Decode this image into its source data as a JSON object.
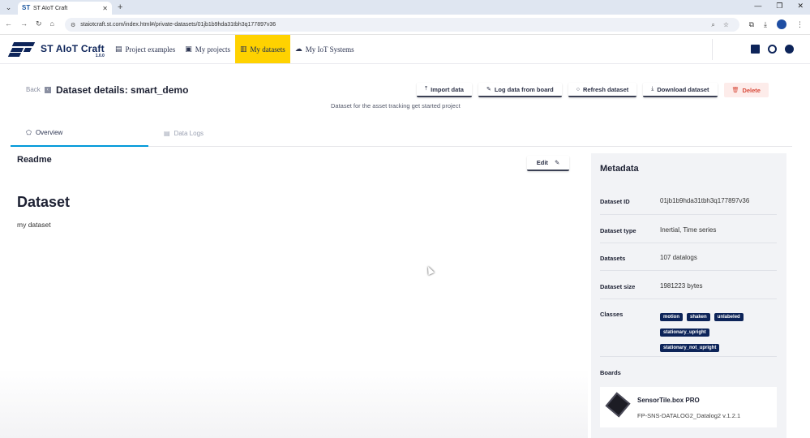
{
  "browser": {
    "tab_title": "ST AIoT Craft",
    "tab_close": "✕",
    "new_tab": "+",
    "url": "staiotcraft.st.com/index.html#/private-datasets/01jb1b9hda31tbh3q177897v36",
    "window_controls": [
      "—",
      "❐",
      "✕"
    ]
  },
  "app": {
    "name": "ST AIoT Craft",
    "version": "1.0.0",
    "nav": [
      {
        "label": "Project examples",
        "icon": "list-icon"
      },
      {
        "label": "My projects",
        "icon": "folder-icon"
      },
      {
        "label": "My datasets",
        "icon": "chart-icon",
        "active": true
      },
      {
        "label": "My IoT Systems",
        "icon": "cloud-icon"
      }
    ]
  },
  "page": {
    "back_label": "Back",
    "title": "Dataset details: smart_demo",
    "subtitle": "Dataset for the asset tracking get started project",
    "actions": {
      "import": "Import data",
      "log": "Log data from board",
      "refresh": "Refresh dataset",
      "download": "Download dataset",
      "delete": "Delete"
    },
    "tabs": {
      "overview": "Overview",
      "logs": "Data Logs"
    }
  },
  "readme": {
    "title": "Readme",
    "edit_label": "Edit",
    "heading": "Dataset",
    "text": "my dataset"
  },
  "metadata": {
    "title": "Metadata",
    "rows": {
      "id": {
        "key": "Dataset ID",
        "value": "01jb1b9hda31tbh3q177897v36"
      },
      "type": {
        "key": "Dataset type",
        "value": "Inertial, Time series"
      },
      "count": {
        "key": "Datasets",
        "value": "107 datalogs"
      },
      "size": {
        "key": "Dataset size",
        "value": "1981223 bytes"
      },
      "classes": {
        "key": "Classes"
      }
    },
    "classes": [
      "motion",
      "shaken",
      "unlabeled",
      "stationary_upright",
      "stationary_not_upright"
    ],
    "boards_label": "Boards",
    "board": {
      "name": "SensorTile.box PRO",
      "firmware": "FP-SNS-DATALOG2_Datalog2 v.1.2.1"
    }
  },
  "colors": {
    "accent_yellow": "#ffd200",
    "brand_navy": "#0d2459",
    "tab_indicator": "#0098d8",
    "danger": "#d84a3a"
  }
}
